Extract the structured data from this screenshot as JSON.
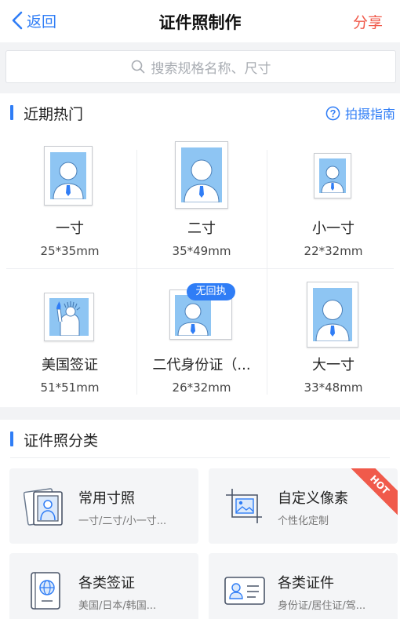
{
  "navbar": {
    "back_label": "返回",
    "title": "证件照制作",
    "share_label": "分享"
  },
  "search": {
    "placeholder": "搜索规格名称、尺寸"
  },
  "hot_section": {
    "title": "近期热门",
    "guide_label": "拍摄指南",
    "items": [
      {
        "name": "一寸",
        "size": "25*35mm"
      },
      {
        "name": "二寸",
        "size": "35*49mm"
      },
      {
        "name": "小一寸",
        "size": "22*32mm"
      },
      {
        "name": "美国签证",
        "size": "51*51mm"
      },
      {
        "name": "二代身份证（...",
        "size": "26*32mm",
        "badge": "无回执"
      },
      {
        "name": "大一寸",
        "size": "33*48mm"
      }
    ]
  },
  "category_section": {
    "title": "证件照分类",
    "cards": [
      {
        "title": "常用寸照",
        "subtitle": "一寸/二寸/小一寸...",
        "icon": "photo-card-icon"
      },
      {
        "title": "自定义像素",
        "subtitle": "个性化定制",
        "icon": "crop-image-icon",
        "ribbon": "HOT"
      },
      {
        "title": "各类签证",
        "subtitle": "美国/日本/韩国...",
        "icon": "passport-icon"
      },
      {
        "title": "各类证件",
        "subtitle": "身份证/居住证/驾...",
        "icon": "id-card-icon"
      }
    ]
  },
  "colors": {
    "accent": "#2f7df6",
    "share": "#f05a4b",
    "photo_bg": "#8ec5f3"
  }
}
